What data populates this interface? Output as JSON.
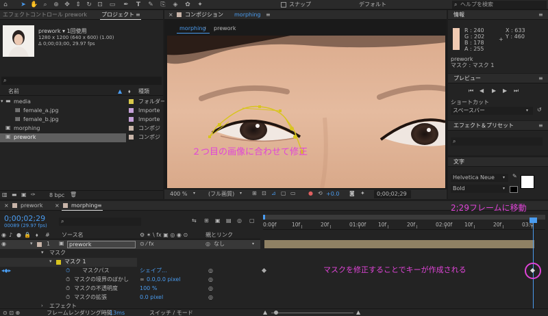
{
  "toolbar": {
    "snap_label": "スナップ",
    "workspace_label": "デフォルト",
    "search_placeholder": "ヘルプを検索"
  },
  "project_panel": {
    "tab_effect_control": "エフェクトコントロール prework",
    "tab_project": "プロジェクト",
    "selected_name": "prework ▾ 1回使用",
    "selected_dims": "1280 x 1200 (640 x 600) (1.00)",
    "selected_duration": "Δ 0;00;03;00, 29.97 fps",
    "search_icon_text": "⌕",
    "col_name": "名前",
    "col_type": "種類",
    "items": [
      {
        "name": "media",
        "type": "フォルダー",
        "color": "#d8c84a"
      },
      {
        "name": "female_a.jpg",
        "type": "Importe",
        "color": "#c4a0d8"
      },
      {
        "name": "female_b.jpg",
        "type": "Importe",
        "color": "#c4a0d8"
      },
      {
        "name": "morphing",
        "type": "コンポジ",
        "color": "#c8b4a8"
      },
      {
        "name": "prework",
        "type": "コンポジ",
        "color": "#c8b4a8"
      }
    ],
    "bpc_label": "8 bpc"
  },
  "composition_panel": {
    "title": "コンポジション",
    "title_comp": "morphing",
    "tab_active": "morphing",
    "tab_other": "prework",
    "annotation": "２つ目の画像に合わせて修正",
    "zoom": "400 %",
    "quality": "(フル画質)",
    "exposure": "+0.0",
    "timecode": "0;00;02;29"
  },
  "info_panel": {
    "title": "情報",
    "r": "R : 240",
    "g": "G : 202",
    "b": "B : 178",
    "a": "A : 255",
    "x": "X : 633",
    "y": "Y : 460",
    "swatch_color": "#f0cab2",
    "layer_name": "prework",
    "mask_name": "マスク : マスク 1"
  },
  "preview_panel": {
    "title": "プレビュー",
    "shortcut_label": "ショートカット",
    "shortcut_value": "スペースバー"
  },
  "effects_panel": {
    "title": "エフェクト＆プリセット",
    "search_icon_text": "⌕"
  },
  "character_panel": {
    "title": "文字",
    "font": "Helvetica Neue",
    "style": "Bold"
  },
  "timeline": {
    "tab_prework": "prework",
    "tab_morphing": "morphing",
    "timecode": "0;00;02;29",
    "frames": "00089 (29.97 fps)",
    "col_source": "ソース名",
    "col_parent": "親とリンク",
    "layer_number": "1",
    "layer_name": "prework",
    "parent_value": "なし",
    "mask_group": "マスク",
    "mask_name": "マスク 1",
    "mask_path_label": "マスクパス",
    "mask_path_value": "シェイプ...",
    "mask_feather_label": "マスクの境界のぼかし",
    "mask_feather_value": "0.0,0.0 pixel",
    "mask_opacity_label": "マスクの不透明度",
    "mask_opacity_value": "100 %",
    "mask_expansion_label": "マスクの拡張",
    "mask_expansion_value": "0.0 pixel",
    "effects_label": "エフェクト",
    "render_time_label": "フレームレンダリング時間",
    "render_time_value": "13ms",
    "switch_mode": "スイッチ / モード",
    "ruler_labels": [
      "0:00f",
      "10f",
      "20f",
      "01:00f",
      "10f",
      "20f",
      "02:00f",
      "10f",
      "20f",
      "03:0"
    ],
    "annotation_move": "2;29フレームに移動",
    "annotation_key": "マスクを修正することでキーが作成される"
  }
}
